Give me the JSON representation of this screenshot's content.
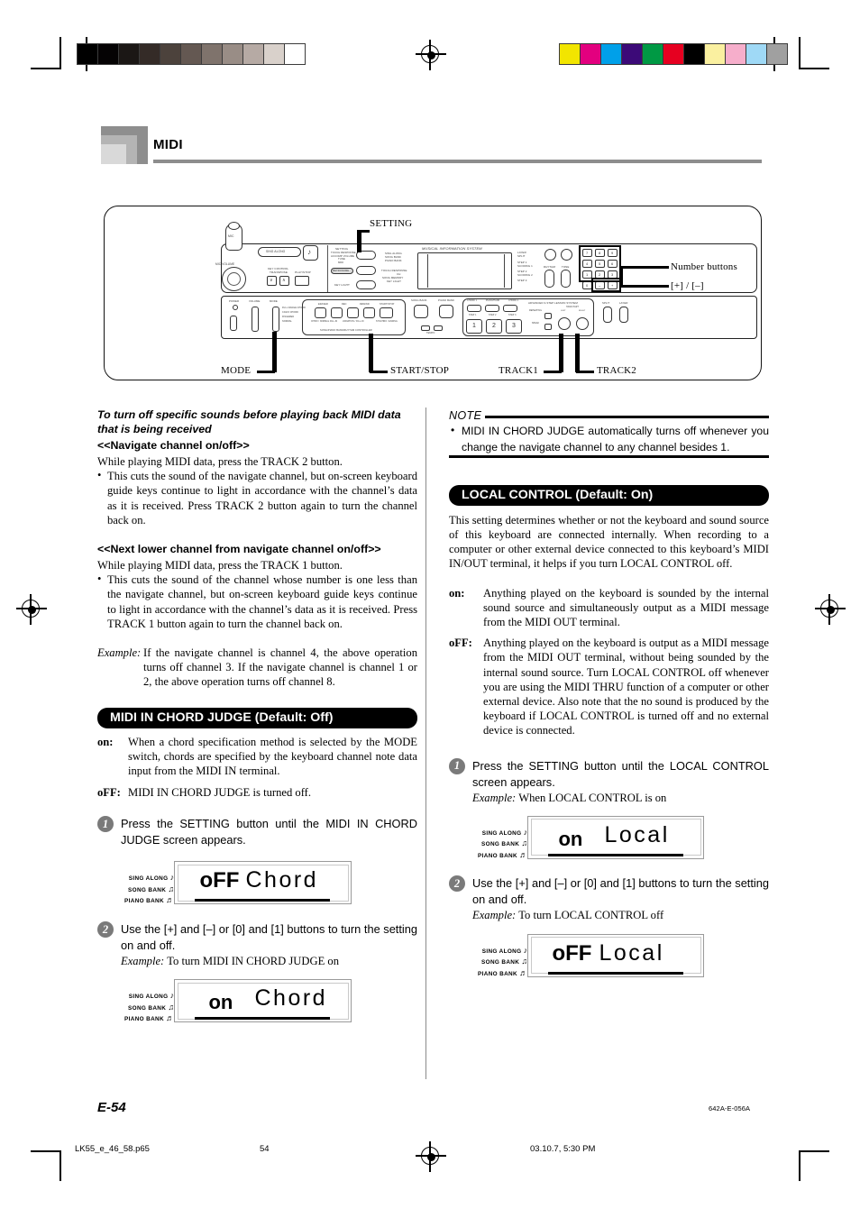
{
  "header": {
    "title": "MIDI"
  },
  "figure": {
    "callouts": {
      "setting": "SETTING",
      "number_buttons": "Number buttons",
      "plus_minus": "[+] / [–]",
      "mode": "MODE",
      "start_stop": "START/STOP",
      "track1": "TRACK1",
      "track2": "TRACK2"
    },
    "panel_labels": {
      "mic": "MIC",
      "mic_volume": "MIC VOLUME",
      "sing_along": "SING ALONG",
      "key_control": "KEY CONTROL",
      "transpose": "TRANSPOSE",
      "play_stop": "PLAY/STOP",
      "setting": "SETTING",
      "touch_response": "TOUCH RESPONSE",
      "accomp_volume": "ACCOMP VOLUME",
      "tune": "TUNE",
      "midi": "MIDI",
      "metronome": "METRONOME",
      "key_light": "KEY LIGHT",
      "mis": "MUSICAL INFORMATION SYSTEM",
      "disp_sing_along": "SING ALONG",
      "disp_song_bank": "SONG BANK",
      "disp_piano_bank": "PIANO BANK",
      "disp_touch_response": "TOUCH RESPONSE",
      "disp_ch": "CH",
      "disp_song_memory": "SONG MEMORY",
      "disp_key_light": "KEY LIGHT",
      "layer": "LAYER",
      "split": "SPLIT",
      "step1": "STEP 1",
      "scoring1": "SCORING 1",
      "step2": "STEP 2",
      "scoring2": "SCORING 2",
      "step3": "STEP 3",
      "rhythm": "RHYTHM",
      "tone": "TONE",
      "power": "POWER",
      "volume": "VOLUME",
      "mode": "MODE",
      "full_range_chord": "FULL RANGE CHORD",
      "casio_chord": "CASIO CHORD",
      "fingered": "FINGERED",
      "normal": "NORMAL",
      "eraser": "ERASER",
      "rec": "REC",
      "rewind": "REWIND",
      "forward": "FORWARD",
      "start_stop": "START/STOP",
      "intro_normal_fill_in": "INTRO / NORMAL FILL-IN",
      "variation_fill_in": "VARIATION / FILL-IN",
      "synchro_ending": "SYNCHRO / ENDING",
      "song_piano_bank_rhythm_controller": "SONG/PIANO BANK/RHYTHM CONTROLLER",
      "song_bank": "SONG BANK",
      "piano_bank": "PIANO BANK",
      "tempo": "TEMPO",
      "chord1": "CHORD 1",
      "piano_hand": "PIANO/HAND",
      "chord2": "CHORD 2",
      "advanced_lesson": "ADVANCED 3-STEP LESSON SYSTEM",
      "repeat": "REPEATING",
      "speak": "SPEAK",
      "left": "LEFT",
      "right": "RIGHT",
      "hand_part": "HAND PART",
      "numbers": [
        "7",
        "8",
        "9",
        "4",
        "5",
        "6",
        "1",
        "2",
        "3",
        "0",
        "–",
        "+"
      ]
    }
  },
  "left_column": {
    "heading_italic": "To turn off specific sounds before playing back MIDI data that is being received",
    "sub1": "<<Navigate channel on/off>>",
    "sub1_intro": "While playing MIDI data, press the TRACK 2 button.",
    "sub1_bullet": "This cuts the sound of the navigate channel, but on-screen keyboard guide keys continue to light in accordance with the channel’s data as it is received. Press TRACK 2 button again to turn the channel back on.",
    "sub2": "<<Next lower channel from navigate channel on/off>>",
    "sub2_intro": "While playing MIDI data, press the TRACK 1 button.",
    "sub2_bullet": "This cuts the sound of the channel whose number is one less than the navigate channel, but on-screen keyboard guide keys continue to light in accordance with the channel’s data as it is received. Press TRACK 1 button again to turn the channel back on.",
    "example_label": "Example:",
    "example_text": "If the navigate channel is channel 4, the above operation turns off channel 3. If the navigate channel is channel 1 or 2, the above operation turns off channel 8.",
    "section_title": "MIDI IN CHORD JUDGE (Default: Off)",
    "def_on_term": "on:",
    "def_on_desc": "When a chord specification method is selected by the MODE switch, chords are specified by the keyboard channel note data input from the MIDI IN terminal.",
    "def_off_term": "oFF:",
    "def_off_desc": "MIDI IN CHORD JUDGE is turned off.",
    "step1_num": "1",
    "step1_text": "Press the SETTING button until the MIDI IN CHORD JUDGE screen appears.",
    "step2_num": "2",
    "step2_text": "Use the [+] and [–] or [0] and [1] buttons to turn the setting on and off.",
    "step2_example_label": "Example:",
    "step2_example_text": "To turn MIDI IN CHORD JUDGE on",
    "lcd1": {
      "value": "oFF",
      "name": "Chord"
    },
    "lcd2": {
      "value": "on",
      "name": "Chord"
    }
  },
  "right_column": {
    "note_title": "NOTE",
    "note_text": "MIDI IN CHORD JUDGE automatically turns off whenever you change the navigate channel to any channel besides 1.",
    "section_title": "LOCAL CONTROL (Default: On)",
    "intro": "This setting determines whether or not the keyboard and sound source of this keyboard are connected internally. When recording to a computer or other external device connected to this keyboard’s MIDI IN/OUT terminal, it helps if you turn LOCAL CONTROL off.",
    "def_on_term": "on:",
    "def_on_desc": "Anything played on the keyboard is sounded by the internal sound source and simultaneously output as a MIDI message from the MIDI OUT terminal.",
    "def_off_term": "oFF:",
    "def_off_desc": "Anything played on the keyboard is output as a MIDI message from the MIDI OUT terminal, without being sounded by the internal sound source. Turn LOCAL CONTROL off whenever you are using the MIDI THRU function of a computer or other external device. Also note that the no sound is produced by the keyboard if LOCAL CONTROL is turned off and no external device is connected.",
    "step1_num": "1",
    "step1_text": "Press the SETTING button until the LOCAL CONTROL screen appears.",
    "step1_example_label": "Example:",
    "step1_example_text": "When LOCAL CONTROL is on",
    "step2_num": "2",
    "step2_text": "Use the [+] and [–] or [0] and [1] buttons to turn the setting on and off.",
    "step2_example_label": "Example:",
    "step2_example_text": "To turn LOCAL CONTROL off",
    "lcd1": {
      "value": "on",
      "name": "Local"
    },
    "lcd2": {
      "value": "oFF",
      "name": "Local"
    }
  },
  "lcd_icon_labels": {
    "sing_along": "SING ALONG",
    "song_bank": "SONG BANK",
    "piano_bank": "PIANO BANK"
  },
  "footer": {
    "page_label": "E-54",
    "doc_code": "642A-E-056A",
    "filename": "LK55_e_46_58.p65",
    "page_number": "54",
    "timestamp": "03.10.7, 5:30 PM"
  },
  "colorbars": {
    "grayscale": [
      "#000000",
      "#050304",
      "#1b1715",
      "#342b27",
      "#4c423c",
      "#645852",
      "#7f736c",
      "#998d86",
      "#b6aaa4",
      "#d9d1cb",
      "#ffffff"
    ],
    "color": [
      "#f2e500",
      "#e3007f",
      "#00a0e9",
      "#3c0a78",
      "#009944",
      "#e60020",
      "#000000",
      "#faf0a0",
      "#f6aecb",
      "#9fd9f6",
      "#a0a0a0"
    ]
  }
}
